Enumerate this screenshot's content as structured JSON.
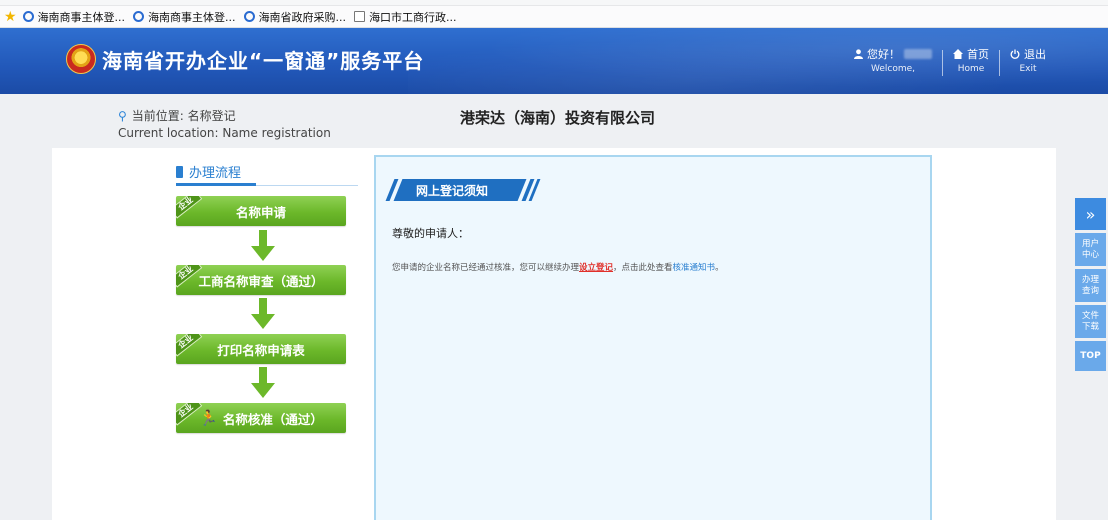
{
  "browser": {
    "bookmarks": [
      {
        "label": "海南商事主体登...",
        "icon": "ie-icon"
      },
      {
        "label": "海南商事主体登...",
        "icon": "ie-icon"
      },
      {
        "label": "海南省政府采购...",
        "icon": "ie-icon"
      },
      {
        "label": "海口市工商行政...",
        "icon": "document-icon"
      }
    ]
  },
  "header": {
    "title": "海南省开办企业“一窗通”服务平台",
    "welcome_cn": "您好！",
    "welcome_en": "Welcome,",
    "home_cn": "首页",
    "home_en": "Home",
    "exit_cn": "退出",
    "exit_en": "Exit"
  },
  "location": {
    "label_cn": "当前位置: 名称登记",
    "label_en": "Current location: Name registration"
  },
  "company": {
    "name": "港荣达（海南）投资有限公司"
  },
  "process": {
    "title": "办理流程",
    "steps": [
      {
        "badge": "企业",
        "label": "名称申请"
      },
      {
        "badge": "企业",
        "label": "工商名称审查（通过）"
      },
      {
        "badge": "企业",
        "label": "打印名称申请表"
      },
      {
        "badge": "企业",
        "label": "名称核准（通过）"
      }
    ]
  },
  "notice": {
    "tab_label": "网上登记须知",
    "greeting": "尊敬的申请人：",
    "text_before": "您申请的企业名称已经通过核准，您可以继续办理",
    "red_link": "设立登记",
    "text_middle": "，点击此处查看",
    "blue_link": "核准通知书",
    "text_after": "。"
  },
  "float_bar": {
    "expand": "»",
    "user_center": "用户中心",
    "process_query": "办理查询",
    "file_download": "文件下载",
    "top": "TOP"
  },
  "colors": {
    "header_blue": "#2258b9",
    "step_green": "#6cb82a",
    "accent_blue": "#2a7fd0",
    "link_red": "#e0302a"
  }
}
